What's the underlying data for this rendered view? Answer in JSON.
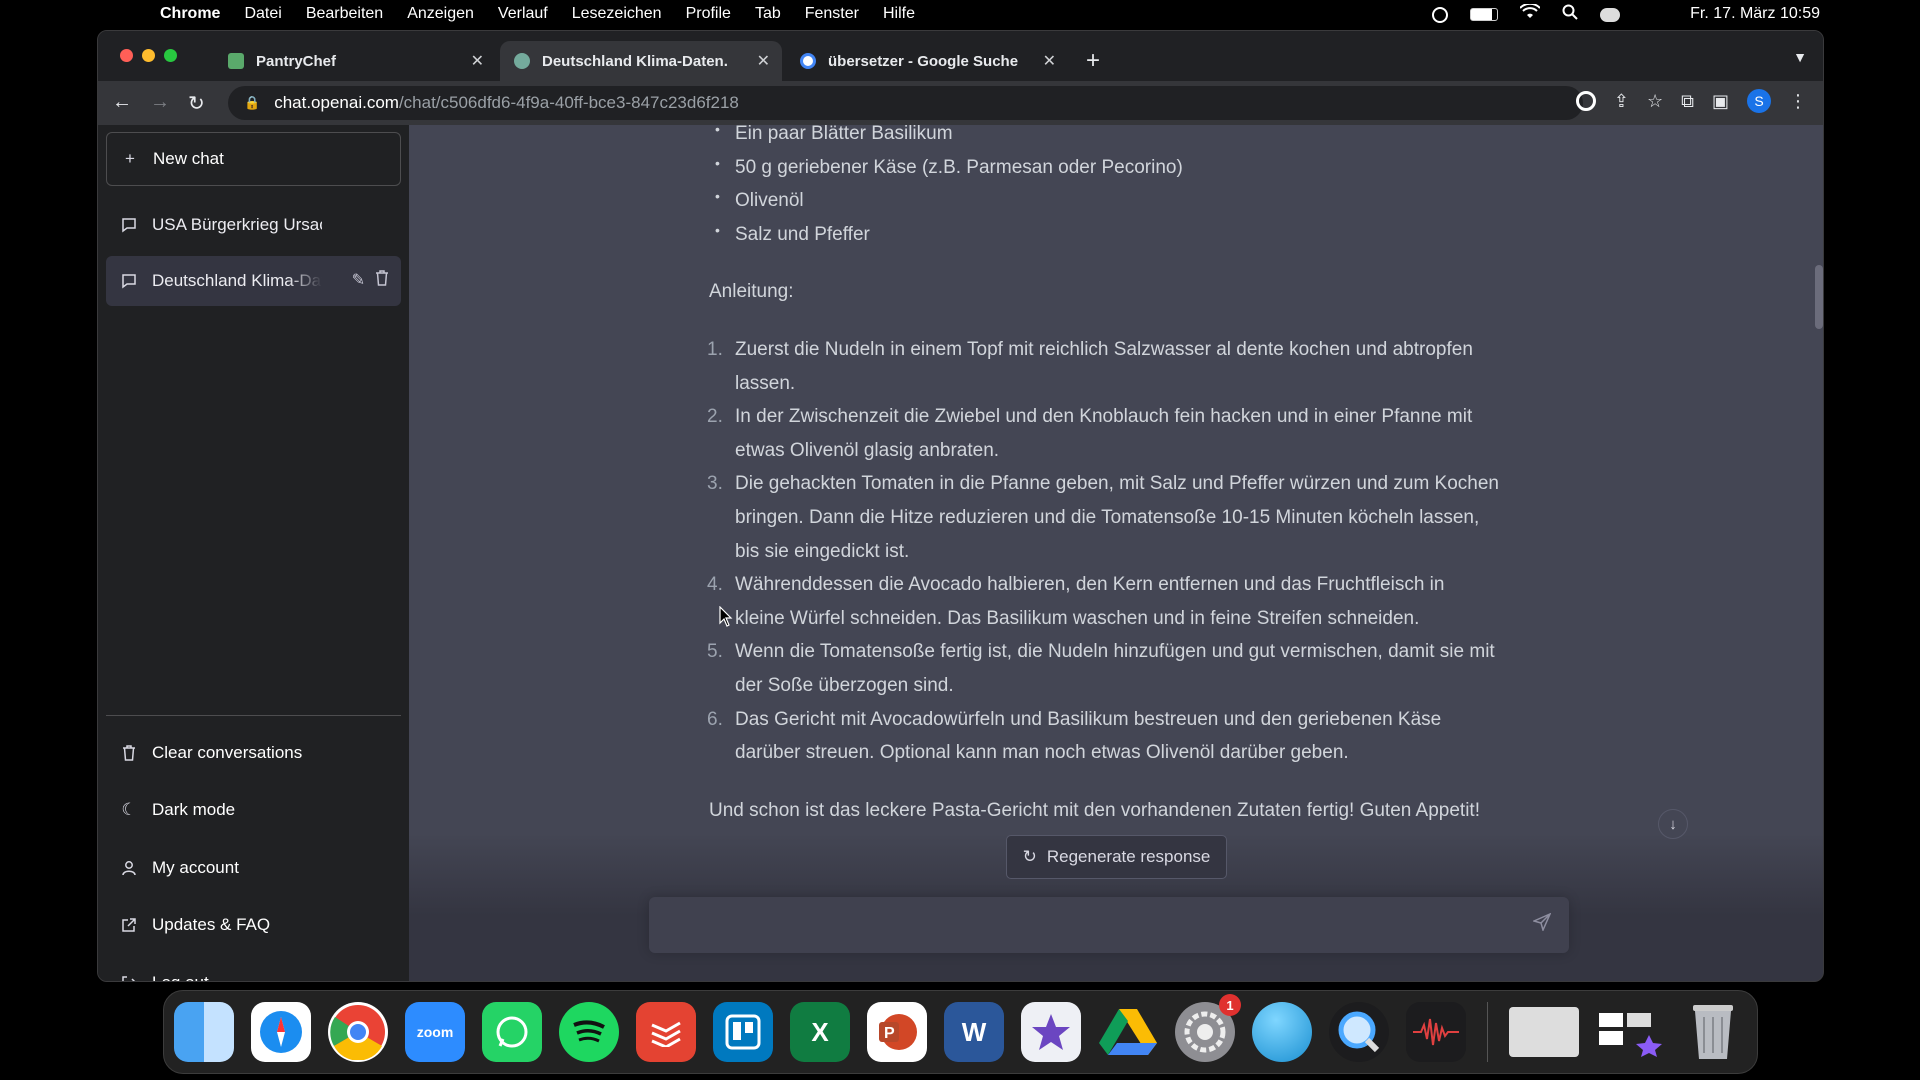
{
  "menubar": {
    "app_name": "Chrome",
    "items": [
      "Datei",
      "Bearbeiten",
      "Anzeigen",
      "Verlauf",
      "Lesezeichen",
      "Profile",
      "Tab",
      "Fenster",
      "Hilfe"
    ],
    "clock": "Fr. 17. März 10:59"
  },
  "tabs": [
    {
      "title": "PantryChef",
      "active": false
    },
    {
      "title": "Deutschland Klima-Daten.",
      "active": true
    },
    {
      "title": "übersetzer - Google Suche",
      "active": false
    }
  ],
  "address": {
    "host": "chat.openai.com",
    "path": "/chat/c506dfd6-4f9a-40ff-bce3-847c23d6f218"
  },
  "profile": {
    "initial": "S"
  },
  "sidebar": {
    "new_chat": "New chat",
    "conversations": [
      {
        "label": "USA Bürgerkrieg Ursache"
      },
      {
        "label": "Deutschland Klima-Daten"
      }
    ],
    "bottom": {
      "clear": "Clear conversations",
      "dark_mode": "Dark mode",
      "account": "My account",
      "faq": "Updates & FAQ",
      "logout": "Log out"
    }
  },
  "message": {
    "bullets": [
      "Ein paar Blätter Basilikum",
      "50 g geriebener Käse (z.B. Parmesan oder Pecorino)",
      "Olivenöl",
      "Salz und Pfeffer"
    ],
    "heading": "Anleitung:",
    "steps": [
      {
        "num": "1.",
        "text": "Zuerst die Nudeln in einem Topf mit reichlich Salzwasser al dente kochen und abtropfen lassen."
      },
      {
        "num": "2.",
        "text": "In der Zwischenzeit die Zwiebel und den Knoblauch fein hacken und in einer Pfanne mit etwas Olivenöl glasig anbraten."
      },
      {
        "num": "3.",
        "text": "Die gehackten Tomaten in die Pfanne geben, mit Salz und Pfeffer würzen und zum Kochen bringen. Dann die Hitze reduzieren und die Tomatensoße 10-15 Minuten köcheln lassen, bis sie eingedickt ist."
      },
      {
        "num": "4.",
        "text": "Währenddessen die Avocado halbieren, den Kern entfernen und das Fruchtfleisch in kleine Würfel schneiden. Das Basilikum waschen und in feine Streifen schneiden."
      },
      {
        "num": "5.",
        "text": "Wenn die Tomatensoße fertig ist, die Nudeln hinzufügen und gut vermischen, damit sie mit der Soße überzogen sind."
      },
      {
        "num": "6.",
        "text": "Das Gericht mit Avocadowürfeln und Basilikum bestreuen und den geriebenen Käse darüber streuen. Optional kann man noch etwas Olivenöl darüber geben."
      }
    ],
    "outro": "Und schon ist das leckere Pasta-Gericht mit den vorhandenen Zutaten fertig! Guten Appetit!"
  },
  "composer": {
    "regenerate": "Regenerate response",
    "placeholder": ""
  },
  "dock": {
    "zoom_label": "zoom",
    "excel_label": "X",
    "word_label": "W",
    "trello_label": "T",
    "settings_badge": "1"
  },
  "colors": {
    "sidebar_bg": "#202123",
    "main_bg": "#444654",
    "accent_blue": "#1a73e8"
  }
}
